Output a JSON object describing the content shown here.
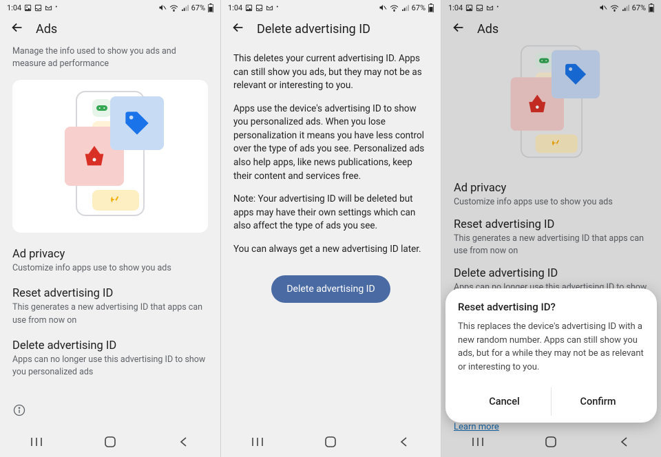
{
  "status": {
    "time": "1:04",
    "battery": "67%"
  },
  "screen1": {
    "title": "Ads",
    "desc": "Manage the info used to show you ads and measure ad performance",
    "items": [
      {
        "title": "Ad privacy",
        "sub": "Customize info apps use to show you ads"
      },
      {
        "title": "Reset advertising ID",
        "sub": "This generates a new advertising ID that apps can use from now on"
      },
      {
        "title": "Delete advertising ID",
        "sub": "Apps can no longer use this advertising ID to show you personalized ads"
      }
    ]
  },
  "screen2": {
    "title": "Delete advertising ID",
    "p1": "This deletes your current advertising ID. Apps can still show you ads, but they may not be as relevant or interesting to you.",
    "p2": "Apps use the device's advertising ID to show you personalized ads. When you lose personalization it means you have less control over the type of ads you see. Personalized ads also help apps, like news publications, keep their content and services free.",
    "p3": "Note: Your advertising ID will be deleted but apps may have their own settings which can also affect the type of ads you see.",
    "p4": "You can always get a new advertising ID later.",
    "button": "Delete advertising ID"
  },
  "screen3": {
    "title": "Ads",
    "items": [
      {
        "title": "Ad privacy",
        "sub": "Customize info apps use to show you ads"
      },
      {
        "title": "Reset advertising ID",
        "sub": "This generates a new advertising ID that apps can use from now on"
      },
      {
        "title": "Delete advertising ID",
        "sub": "Apps can no longer use this advertising ID to show you"
      }
    ],
    "learn_more": "Learn more",
    "dialog": {
      "title": "Reset advertising ID?",
      "body": "This replaces the device's advertising ID with a new random number. Apps can still show you ads, but for a while they may not be as relevant or interesting to you.",
      "cancel": "Cancel",
      "confirm": "Confirm"
    }
  }
}
